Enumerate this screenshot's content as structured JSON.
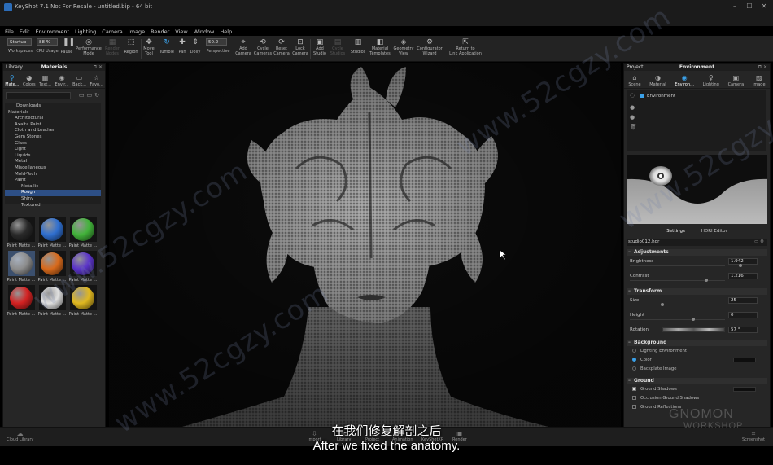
{
  "window": {
    "title": "KeyShot 7.1 Not For Resale - untitled.bip - 64 bit",
    "controls": [
      "–",
      "☐",
      "✕"
    ]
  },
  "menu": [
    "File",
    "Edit",
    "Environment",
    "Lighting",
    "Camera",
    "Image",
    "Render",
    "View",
    "Window",
    "Help"
  ],
  "toolbar": {
    "workspace_select": "Startup",
    "cpu_value": "88 %",
    "pause_icon": "pause-icon",
    "fov_value": "50.2",
    "buttons": [
      {
        "label": "Workspaces"
      },
      {
        "label": "CPU Usage"
      },
      {
        "label": "Pause"
      },
      {
        "label": "Performance\nMode"
      },
      {
        "label": "Render\nNodes"
      },
      {
        "label": "Region"
      },
      {
        "label": "Move\nTool"
      },
      {
        "label": "Tumble"
      },
      {
        "label": "Pan"
      },
      {
        "label": "Dolly"
      },
      {
        "label": "Perspective"
      },
      {
        "label": "Add\nCamera"
      },
      {
        "label": "Cycle\nCameras"
      },
      {
        "label": "Reset\nCamera"
      },
      {
        "label": "Lock\nCamera"
      },
      {
        "label": "Add\nStudio"
      },
      {
        "label": "Cycle\nStudios"
      },
      {
        "label": "Studios"
      },
      {
        "label": "Material\nTemplates"
      },
      {
        "label": "Geometry\nView"
      },
      {
        "label": "Configurator\nWizard"
      },
      {
        "label": "Return to\nLink Application"
      }
    ]
  },
  "library": {
    "header": "Library",
    "title": "Materials",
    "tabs": [
      "Mate...",
      "Colors",
      "Text...",
      "Envir...",
      "Back...",
      "Favo..."
    ],
    "search_placeholder": "",
    "tree": [
      "Downloads",
      "Materials",
      "Architectural",
      "Axalta Paint",
      "Cloth and Leather",
      "Gem Stones",
      "Glass",
      "Light",
      "Liquids",
      "Metal",
      "Miscellaneous",
      "Mold-Tech",
      "Paint",
      "Metallic",
      "Rough",
      "Shiny",
      "Textured"
    ],
    "thumbnails": [
      {
        "label": "Paint Matte ...",
        "color": "#2a2a2a"
      },
      {
        "label": "Paint Matte ...",
        "color": "#2f6fd0"
      },
      {
        "label": "Paint Matte ...",
        "color": "#42b33a"
      },
      {
        "label": "Paint Matte ...",
        "color": "#8d8d8d"
      },
      {
        "label": "Paint Matte ...",
        "color": "#d86a1c"
      },
      {
        "label": "Paint Matte ...",
        "color": "#5b34c9"
      },
      {
        "label": "Paint Matte ...",
        "color": "#d42222"
      },
      {
        "label": "Paint Matte ...",
        "color": "#e0e0e0"
      },
      {
        "label": "Paint Matte ...",
        "color": "#e0b820"
      }
    ],
    "footer_label": "Cloud Library"
  },
  "project": {
    "header": "Project",
    "title": "Environment",
    "tabs": [
      "Scene",
      "Material",
      "Environ...",
      "Lighting",
      "Camera",
      "Image"
    ],
    "env_item": "Environment",
    "subtabs": [
      "Settings",
      "HDRI Editor"
    ],
    "hdri_file": "studio012.hdr",
    "adjustments": {
      "title": "Adjustments",
      "brightness_label": "Brightness",
      "brightness": "1.942",
      "contrast_label": "Contrast",
      "contrast": "1.216"
    },
    "transform": {
      "title": "Transform",
      "size_label": "Size",
      "size": "25",
      "height_label": "Height",
      "height": "0",
      "rotation_label": "Rotation",
      "rotation": "57 °"
    },
    "background": {
      "title": "Background",
      "opt1": "Lighting Environment",
      "opt2": "Color",
      "opt3": "Backplate Image"
    },
    "ground": {
      "title": "Ground",
      "opt1": "Ground Shadows",
      "opt2": "Occlusion Ground Shadows",
      "opt3": "Ground Reflections"
    }
  },
  "bottombar": {
    "buttons": [
      "Import",
      "Library",
      "Project",
      "Animation",
      "KeyShotXR",
      "Render"
    ],
    "screenshot": "Screenshot"
  },
  "overlay": {
    "subtitle_cn": "在我们修复解剖之后",
    "subtitle_en": "After we fixed the anatomy.",
    "watermark": "www.52cgzy.com",
    "brand_top": "GNOMON",
    "brand_bottom": "WORKSHOP"
  }
}
